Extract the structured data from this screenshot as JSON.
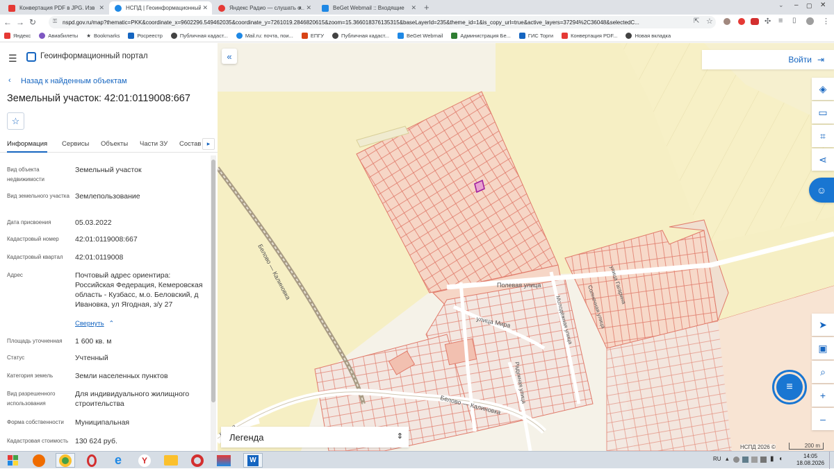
{
  "browser": {
    "tabs": [
      {
        "title": "Конвертация PDF в JPG. Извле...",
        "color": "#e53935",
        "active": false
      },
      {
        "title": "НСПД | Геоинформационный п...",
        "color": "#1e88e5",
        "active": true
      },
      {
        "title": "Яндекс Радио — слушать о...",
        "color": "#e53935",
        "active": false
      },
      {
        "title": "BeGet Webmail :: Входящие",
        "color": "#1e88e5",
        "active": false
      }
    ],
    "url": "nspd.gov.ru/map?thematic=PKK&coordinate_x=9602296.549462035&coordinate_y=7261019.2846820615&zoom=15.366018376135315&baseLayerId=235&theme_id=1&is_copy_url=true&active_layers=37294%2C36048&selectedC...",
    "bookmarks": [
      {
        "label": "Яндекс",
        "color": "#e53935"
      },
      {
        "label": "Авиабилеты",
        "color": "#7e57c2"
      },
      {
        "label": "Bookmarks",
        "color": "#424242"
      },
      {
        "label": "Росреестр",
        "color": "#1565c0"
      },
      {
        "label": "Публичная кадаст...",
        "color": "#424242"
      },
      {
        "label": "Mail.ru: почта, пои...",
        "color": "#1e88e5"
      },
      {
        "label": "ЕПГУ",
        "color": "#d84315"
      },
      {
        "label": "Публичная кадаст...",
        "color": "#424242"
      },
      {
        "label": "BeGet Webmail",
        "color": "#1e88e5"
      },
      {
        "label": "Администрация Бе...",
        "color": "#2e7d32"
      },
      {
        "label": "ГИС Торги",
        "color": "#1565c0"
      },
      {
        "label": "Конвертация PDF...",
        "color": "#e53935"
      },
      {
        "label": "Новая вкладка",
        "color": "#424242"
      }
    ]
  },
  "portal": {
    "title": "Геоинформационный портал",
    "back": "Назад к найденным объектам",
    "object_title": "Земельный участок: 42:01:0119008:667",
    "tabs": [
      "Информация",
      "Сервисы",
      "Объекты",
      "Части ЗУ",
      "Состав"
    ],
    "collapse": "Свернуть",
    "info": [
      {
        "label": "Вид объекта недвижимости",
        "value": "Земельный участок"
      },
      {
        "label": "Вид земельного участка",
        "value": "Землепользование"
      },
      {
        "label": "Дата присвоения",
        "value": "05.03.2022"
      },
      {
        "label": "Кадастровый номер",
        "value": "42:01:0119008:667"
      },
      {
        "label": "Кадастровый квартал",
        "value": "42:01:0119008"
      },
      {
        "label": "Адрес",
        "value": "Почтовый адрес ориентира: Российская Федерация, Кемеровская область - Кузбасс, м.о. Беловский, д Ивановка, ул Ягодная, з/у 27"
      },
      {
        "label": "Площадь уточненная",
        "value": "1 600 кв. м"
      },
      {
        "label": "Статус",
        "value": "Учтенный"
      },
      {
        "label": "Категория земель",
        "value": "Земли населенных пунктов"
      },
      {
        "label": "Вид разрешенного использования",
        "value": "Для индивидуального жилищного строительства"
      },
      {
        "label": "Форма собственности",
        "value": "Муниципальная"
      },
      {
        "label": "Кадастровая стоимость",
        "value": "130 624 руб."
      }
    ]
  },
  "map": {
    "login": "Войти",
    "legend": "Легенда",
    "copyright": "НСПД 2026 ©",
    "scale": "200 m",
    "streets": {
      "polevaya": "Полевая улица",
      "mira": "улица Мира",
      "molodezhnaya": "Молодёжная улица",
      "solnechnaya": "Солнечная улица",
      "gagarina": "улица Гагарина",
      "radujnaya": "Радужная улица",
      "belovo1": "Белово — Калиновка",
      "belovo2": "Белово — Калиновка",
      "kirovsk": "ирская"
    }
  },
  "taskbar": {
    "lang": "RU",
    "time": "14:05",
    "date": "18.08.2026"
  }
}
